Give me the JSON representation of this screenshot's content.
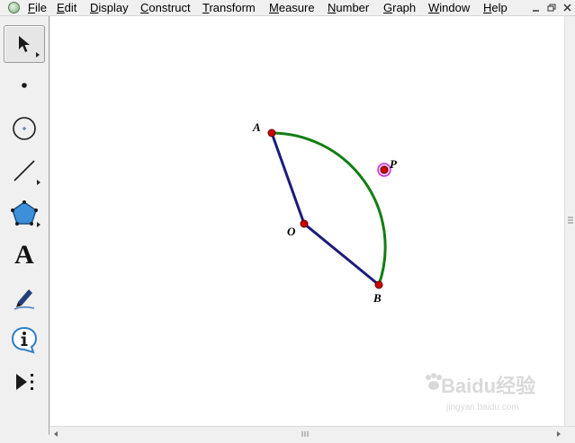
{
  "menu": {
    "items": [
      {
        "label": "File",
        "accel": "F",
        "rest": "ile"
      },
      {
        "label": "Edit",
        "accel": "E",
        "rest": "dit"
      },
      {
        "label": "Display",
        "accel": "D",
        "rest": "isplay"
      },
      {
        "label": "Construct",
        "accel": "C",
        "rest": "onstruct"
      },
      {
        "label": "Transform",
        "accel": "T",
        "rest": "ransform"
      },
      {
        "label": "Measure",
        "accel": "M",
        "rest": "easure"
      },
      {
        "label": "Number",
        "accel": "N",
        "rest": "umber"
      },
      {
        "label": "Graph",
        "accel": "G",
        "rest": "raph"
      },
      {
        "label": "Window",
        "accel": "W",
        "rest": "indow"
      },
      {
        "label": "Help",
        "accel": "H",
        "rest": "elp"
      }
    ],
    "window_buttons": [
      "minimize-icon",
      "restore-icon",
      "close-icon"
    ]
  },
  "toolbox": {
    "tools": [
      {
        "name": "arrow-select-tool",
        "icon": "pointer-arrow-icon",
        "selected": true
      },
      {
        "name": "point-tool",
        "icon": "point-icon",
        "selected": false
      },
      {
        "name": "compass-tool",
        "icon": "circle-icon",
        "selected": false
      },
      {
        "name": "straightedge-tool",
        "icon": "line-segment-icon",
        "selected": false
      },
      {
        "name": "polygon-tool",
        "icon": "pentagon-icon",
        "selected": false
      },
      {
        "name": "text-tool",
        "icon": "text-a-icon",
        "label": "A",
        "selected": false
      },
      {
        "name": "marker-tool",
        "icon": "pen-marker-icon",
        "selected": false
      },
      {
        "name": "information-tool",
        "icon": "info-icon",
        "selected": false
      },
      {
        "name": "custom-tool",
        "icon": "play-dots-icon",
        "selected": false
      }
    ]
  },
  "sketch": {
    "points": {
      "A": "A",
      "O": "O",
      "B": "B",
      "P": "P"
    },
    "segments": [
      "OA",
      "OB"
    ],
    "arc": "AB through P",
    "colors": {
      "segment": "#1c1c7a",
      "arc": "#137d13",
      "point_fill": "#cc0000",
      "selected_point_ring": "#cc33cc"
    }
  },
  "watermark": {
    "brand": "Baidu经验",
    "url": "jingyan.baidu.com"
  }
}
